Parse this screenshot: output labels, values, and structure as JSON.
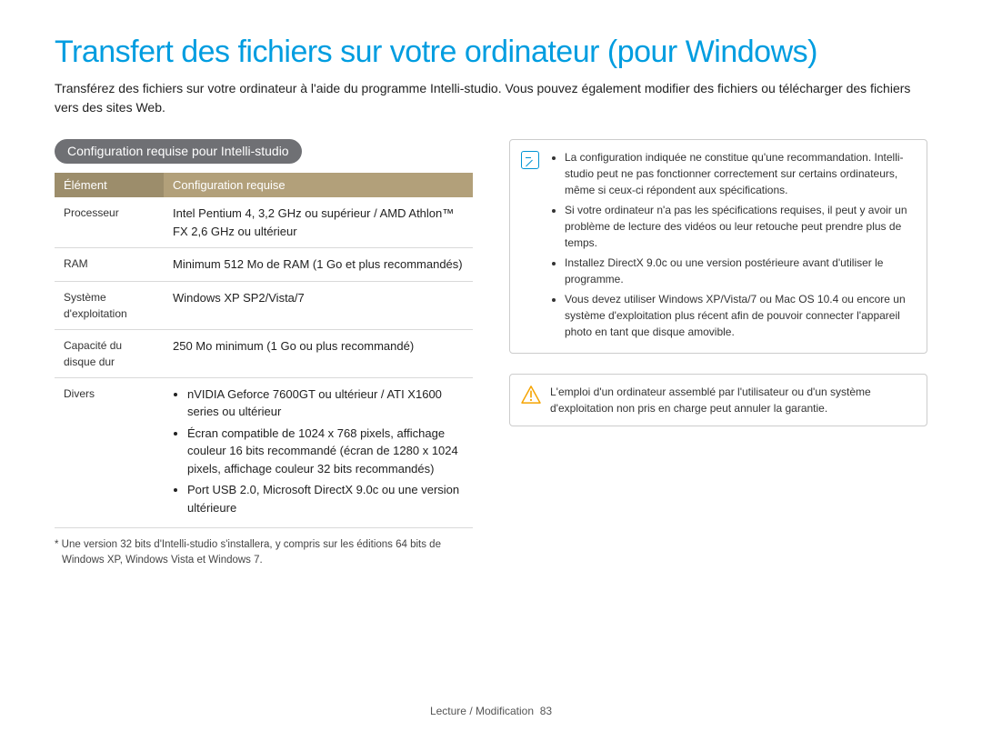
{
  "title": "Transfert des fichiers sur votre ordinateur (pour Windows)",
  "intro": "Transférez des fichiers sur votre ordinateur à l'aide du programme Intelli-studio. Vous pouvez également modifier des fichiers ou télécharger des fichiers vers des sites Web.",
  "section_heading": "Configuration requise pour Intelli-studio",
  "table": {
    "header": {
      "col1": "Élément",
      "col2": "Configuration requise"
    },
    "rows": {
      "r0": {
        "label": "Processeur",
        "value": "Intel Pentium 4, 3,2 GHz ou supérieur / AMD Athlon™ FX 2,6 GHz ou ultérieur"
      },
      "r1": {
        "label": "RAM",
        "value": "Minimum 512 Mo de RAM (1 Go et plus recommandés)"
      },
      "r2": {
        "label": "Système d'exploitation",
        "value": "Windows XP SP2/Vista/7"
      },
      "r3": {
        "label": "Capacité du disque dur",
        "value": "250 Mo minimum (1 Go ou plus recommandé)"
      },
      "r4": {
        "label": "Divers",
        "bullets": {
          "b0": "nVIDIA Geforce 7600GT ou ultérieur / ATI X1600 series ou ultérieur",
          "b1": "Écran compatible de 1024 x 768 pixels, affichage couleur 16 bits recommandé (écran de 1280 x 1024 pixels, affichage couleur 32 bits recommandés)",
          "b2": "Port USB 2.0, Microsoft DirectX 9.0c ou une version ultérieure"
        }
      }
    }
  },
  "footnote": "* Une version 32 bits d'Intelli-studio s'installera, y compris sur les éditions 64 bits de Windows XP, Windows Vista et Windows 7.",
  "note": {
    "bullets": {
      "b0": "La configuration indiquée ne constitue qu'une recommandation. Intelli-studio peut ne pas fonctionner correctement sur certains ordinateurs, même si ceux-ci répondent aux spécifications.",
      "b1": "Si votre ordinateur n'a pas les spécifications requises, il peut y avoir un problème de lecture des vidéos ou leur retouche peut prendre plus de temps.",
      "b2": "Installez DirectX 9.0c ou une version postérieure avant d'utiliser le programme.",
      "b3": "Vous devez utiliser Windows XP/Vista/7 ou Mac OS 10.4 ou encore un système d'exploitation plus récent afin de pouvoir connecter l'appareil photo en tant que disque amovible."
    }
  },
  "warning": "L'emploi d'un ordinateur assemblé par l'utilisateur ou d'un système d'exploitation non pris en charge peut annuler la garantie.",
  "footer": {
    "section": "Lecture / Modification",
    "page": "83"
  }
}
